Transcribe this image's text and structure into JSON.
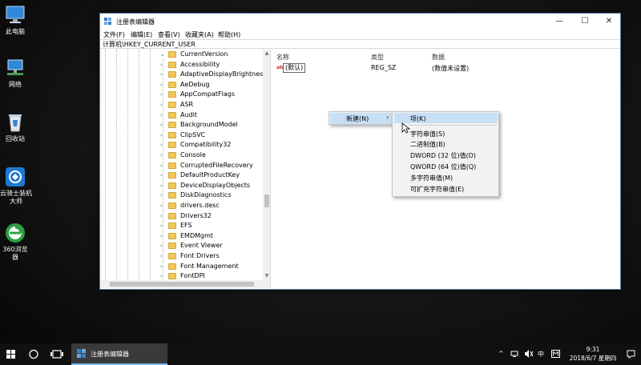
{
  "desktop": {
    "icons": [
      {
        "label": "此电脑"
      },
      {
        "label": "网络"
      },
      {
        "label": "回收站"
      },
      {
        "label": "云骑士装机大师"
      },
      {
        "label": "360浏览器"
      }
    ]
  },
  "window": {
    "title": "注册表编辑器",
    "controls": {
      "minimize": "—",
      "maximize": "☐",
      "close": "✕"
    },
    "menu": [
      "文件(F)",
      "编辑(E)",
      "查看(V)",
      "收藏夹(A)",
      "帮助(H)"
    ],
    "address": "计算机\\HKEY_CURRENT_USER"
  },
  "tree": {
    "items": [
      {
        "name": "CurrentVersion",
        "expanded": true
      },
      {
        "name": "Accessibility",
        "expanded": false
      },
      {
        "name": "AdaptiveDisplayBrightness",
        "expanded": false
      },
      {
        "name": "AeDebug",
        "expanded": false
      },
      {
        "name": "AppCompatFlags",
        "expanded": false
      },
      {
        "name": "ASR",
        "expanded": false
      },
      {
        "name": "Audit",
        "expanded": false
      },
      {
        "name": "BackgroundModel",
        "expanded": false
      },
      {
        "name": "ClipSVC",
        "expanded": false
      },
      {
        "name": "Compatibility32",
        "expanded": false
      },
      {
        "name": "Console",
        "expanded": false
      },
      {
        "name": "CorruptedFileRecovery",
        "expanded": false
      },
      {
        "name": "DefaultProductKey",
        "expanded": false
      },
      {
        "name": "DeviceDisplayObjects",
        "expanded": false
      },
      {
        "name": "DiskDiagnostics",
        "expanded": false
      },
      {
        "name": "drivers.desc",
        "expanded": false
      },
      {
        "name": "Drivers32",
        "expanded": false
      },
      {
        "name": "EFS",
        "expanded": false
      },
      {
        "name": "EMDMgmt",
        "expanded": false
      },
      {
        "name": "Event Viewer",
        "expanded": false
      },
      {
        "name": "Font Drivers",
        "expanded": false
      },
      {
        "name": "Font Management",
        "expanded": false
      },
      {
        "name": "FontDPI",
        "expanded": false
      }
    ]
  },
  "values": {
    "headers": {
      "name": "名称",
      "type": "类型",
      "data": "数据"
    },
    "rows": [
      {
        "name": "(默认)",
        "type": "REG_SZ",
        "data": "(数值未设置)"
      }
    ]
  },
  "context_menu": {
    "new_label": "新建(N)",
    "submenu": [
      "项(K)",
      "字符串值(S)",
      "二进制值(B)",
      "DWORD (32 位)值(D)",
      "QWORD (64 位)值(Q)",
      "多字符串值(M)",
      "可扩充字符串值(E)"
    ]
  },
  "taskbar": {
    "app_label": "注册表编辑器",
    "ime": "中",
    "time": "9:31",
    "date": "2018/6/7 星期四"
  }
}
